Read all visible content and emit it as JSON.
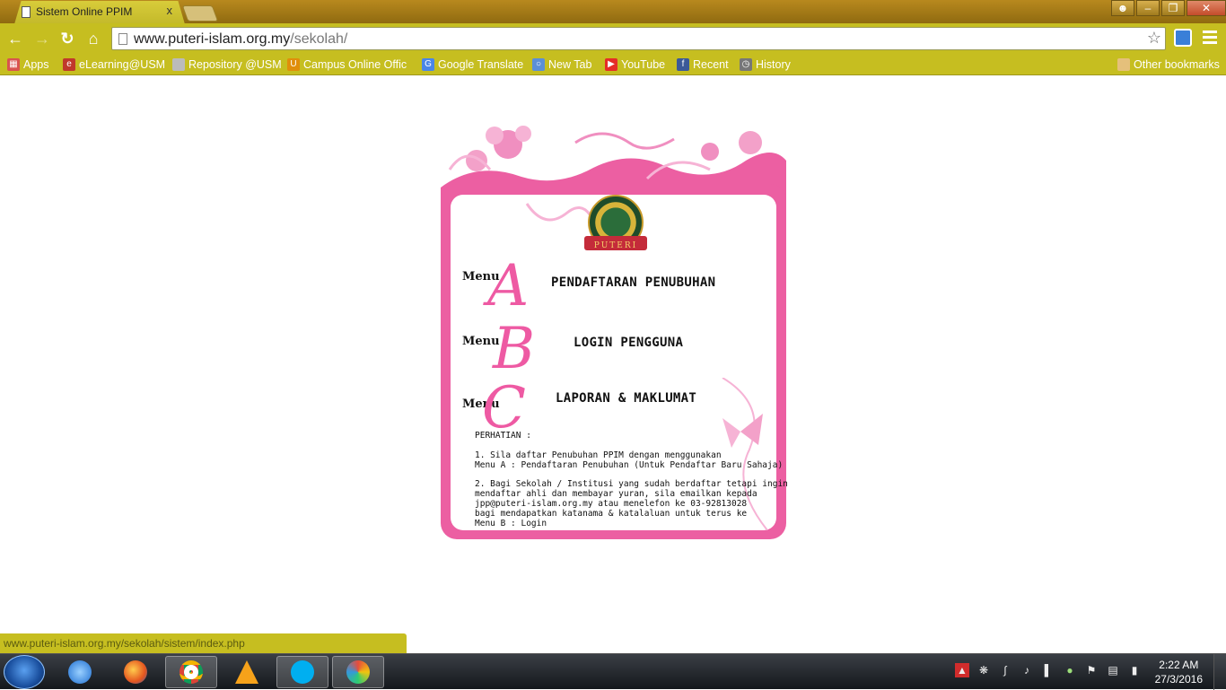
{
  "browser": {
    "tab_title": "Sistem Online PPIM",
    "tab_close": "x",
    "url_host": "www.puteri-islam.org.my",
    "url_path": "/sekolah/",
    "bookmarks": [
      {
        "label": "Apps",
        "icon": "apps-grid-icon",
        "color": "#d9534f"
      },
      {
        "label": "eLearning@USM",
        "icon": "elearning-icon",
        "color": "#c0392b"
      },
      {
        "label": "Repository @USM",
        "icon": "page-icon",
        "color": "#bbbbbb"
      },
      {
        "label": "Campus Online Offic",
        "icon": "campus-icon",
        "color": "#e08e0b"
      },
      {
        "label": "Google Translate",
        "icon": "google-translate-icon",
        "color": "#4a86e8"
      },
      {
        "label": "New Tab",
        "icon": "new-tab-icon",
        "color": "#5b8fd6"
      },
      {
        "label": "YouTube",
        "icon": "youtube-icon",
        "color": "#e52d27"
      },
      {
        "label": "Recent",
        "icon": "facebook-icon",
        "color": "#3b5998"
      },
      {
        "label": "History",
        "icon": "history-icon",
        "color": "#777777"
      }
    ],
    "other_bookmarks": "Other bookmarks",
    "status_url": "www.puteri-islam.org.my/sekolah/sistem/index.php"
  },
  "page": {
    "logo_text": "PUTERI",
    "menus": [
      {
        "word": "Menu",
        "letter": "A",
        "label": "PENDAFTARAN PENUBUHAN"
      },
      {
        "word": "Menu",
        "letter": "B",
        "label": "LOGIN PENGGUNA"
      },
      {
        "word": "Menu",
        "letter": "C",
        "label": "LAPORAN & MAKLUMAT"
      }
    ],
    "notice": {
      "heading": "PERHATIAN :",
      "p1_line1": "1. Sila daftar Penubuhan PPIM dengan menggunakan",
      "p1_line2": "Menu A : Pendaftaran Penubuhan (Untuk Pendaftar Baru Sahaja)",
      "p2_line1": "2. Bagi Sekolah / Institusi yang sudah berdaftar tetapi ingin",
      "p2_line2": "mendaftar ahli dan membayar yuran, sila emailkan kepada",
      "p2_line3": "jpp@puteri-islam.org.my atau menelefon ke 03-92813028",
      "p2_line4": "bagi mendapatkan katanama & katalaluan untuk terus ke",
      "p2_line5": "Menu B : Login"
    }
  },
  "taskbar": {
    "time": "2:22 AM",
    "date": "27/3/2016"
  },
  "colors": {
    "chrome_accent": "#c6be20",
    "pink": "#ec5fa2",
    "menu_letter": "#ee5aa3"
  }
}
